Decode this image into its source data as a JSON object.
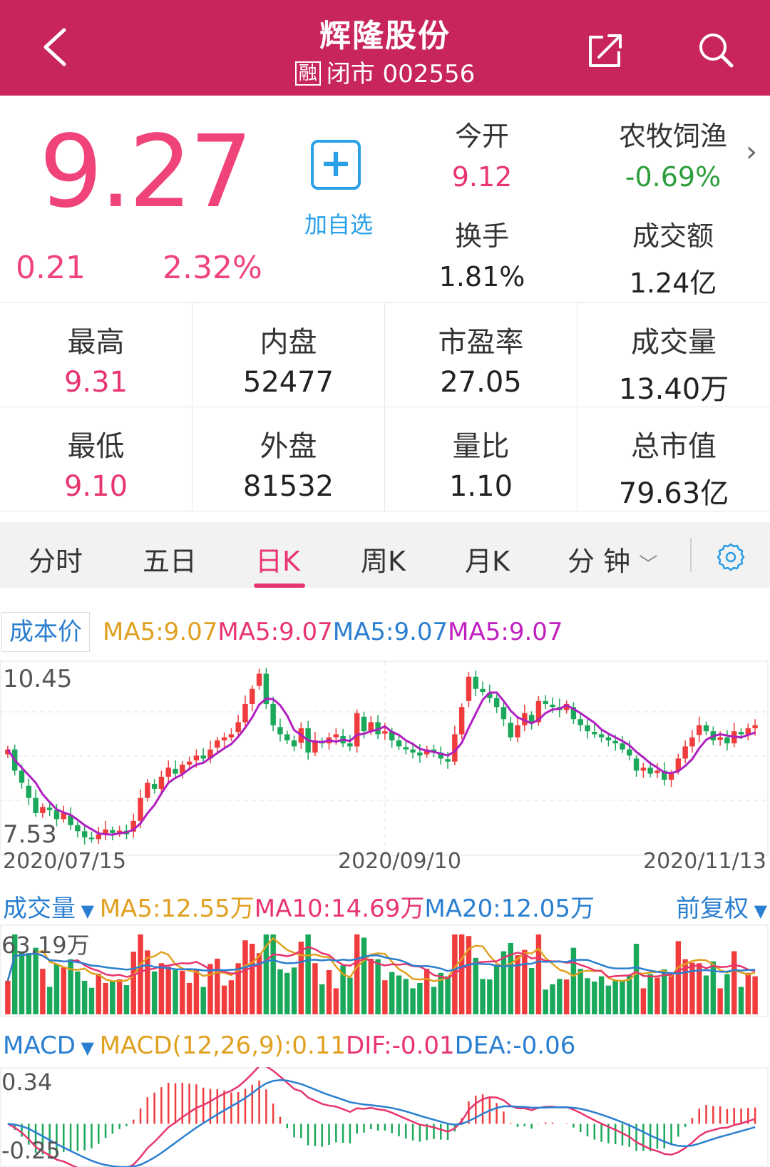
{
  "header": {
    "title": "辉隆股份",
    "badge": "融",
    "status": "闭市 002556"
  },
  "quote": {
    "price": "9.27",
    "change": "0.21",
    "change_pct": "2.32%",
    "add_label": "加自选",
    "open_label": "今开",
    "open_value": "9.12",
    "sector_label": "农牧饲渔",
    "sector_value": "-0.69%",
    "turnover_label": "换手",
    "turnover_value": "1.81%",
    "amount_label": "成交额",
    "amount_value": "1.24亿"
  },
  "stats": [
    {
      "label": "最高",
      "value": "9.31"
    },
    {
      "label": "内盘",
      "value": "52477"
    },
    {
      "label": "市盈率",
      "value": "27.05"
    },
    {
      "label": "成交量",
      "value": "13.40万"
    },
    {
      "label": "最低",
      "value": "9.10"
    },
    {
      "label": "外盘",
      "value": "81532"
    },
    {
      "label": "量比",
      "value": "1.10"
    },
    {
      "label": "总市值",
      "value": "79.63亿"
    }
  ],
  "tabs": [
    "分时",
    "五日",
    "日K",
    "周K",
    "月K",
    "分 钟"
  ],
  "active_tab": "日K",
  "kline": {
    "cost_label": "成本价",
    "ma_legends": [
      {
        "text": "MA5:9.07",
        "color": "#e0a020"
      },
      {
        "text": "MA5:9.07",
        "color": "#e8356e"
      },
      {
        "text": "MA5:9.07",
        "color": "#2a7fd0"
      },
      {
        "text": "MA5:9.07",
        "color": "#c020c0"
      }
    ],
    "y_max": "10.45",
    "y_min": "7.53",
    "dates": [
      "2020/07/15",
      "2020/09/10",
      "2020/11/13"
    ]
  },
  "volume": {
    "label": "成交量",
    "ma5": "MA5:12.55万",
    "ma10": "MA10:14.69万",
    "ma20": "MA20:12.05万",
    "adjust": "前复权",
    "y_max": "63.19万"
  },
  "macd": {
    "label": "MACD",
    "params": "MACD(12,26,9):0.11",
    "dif": "DIF:-0.01",
    "dea": "DEA:-0.06",
    "y_max": "0.34",
    "y_min": "-0.25"
  },
  "colors": {
    "header_bg": "#c8265a",
    "up": "#f03c3c",
    "down": "#1aa85a",
    "accent_blue": "#2a7fd0"
  },
  "chart_data": {
    "type": "candlestick",
    "y_range": [
      7.53,
      10.45
    ],
    "x_ticks": [
      "2020/07/15",
      "2020/09/10",
      "2020/11/13"
    ],
    "close": [
      9.1,
      8.75,
      8.55,
      8.3,
      8.05,
      8.15,
      8.1,
      7.95,
      8.05,
      7.85,
      7.75,
      7.65,
      7.62,
      7.7,
      7.78,
      7.72,
      7.76,
      7.7,
      7.92,
      8.3,
      8.55,
      8.45,
      8.65,
      8.8,
      8.7,
      8.85,
      8.9,
      9.0,
      8.95,
      9.1,
      9.25,
      9.3,
      9.35,
      9.55,
      9.85,
      10.1,
      10.35,
      9.85,
      9.5,
      9.35,
      9.25,
      9.15,
      9.45,
      9.05,
      9.25,
      9.2,
      9.3,
      9.35,
      9.2,
      9.15,
      9.7,
      9.4,
      9.55,
      9.35,
      9.4,
      9.25,
      9.15,
      9.1,
      9.05,
      9.0,
      9.1,
      9.05,
      8.95,
      8.9,
      9.35,
      9.8,
      10.3,
      10.1,
      10.05,
      9.95,
      9.8,
      9.6,
      9.3,
      9.5,
      9.7,
      9.55,
      9.9,
      9.85,
      9.8,
      9.75,
      9.85,
      9.6,
      9.5,
      9.4,
      9.35,
      9.3,
      9.25,
      9.2,
      9.1,
      9.0,
      8.75,
      8.8,
      8.7,
      8.75,
      8.6,
      8.7,
      8.95,
      9.15,
      9.3,
      9.5,
      9.4,
      9.25,
      9.3,
      9.2,
      9.4,
      9.35,
      9.45,
      9.5
    ],
    "volume_max": "63.19万",
    "macd_range": [
      -0.25,
      0.34
    ]
  }
}
